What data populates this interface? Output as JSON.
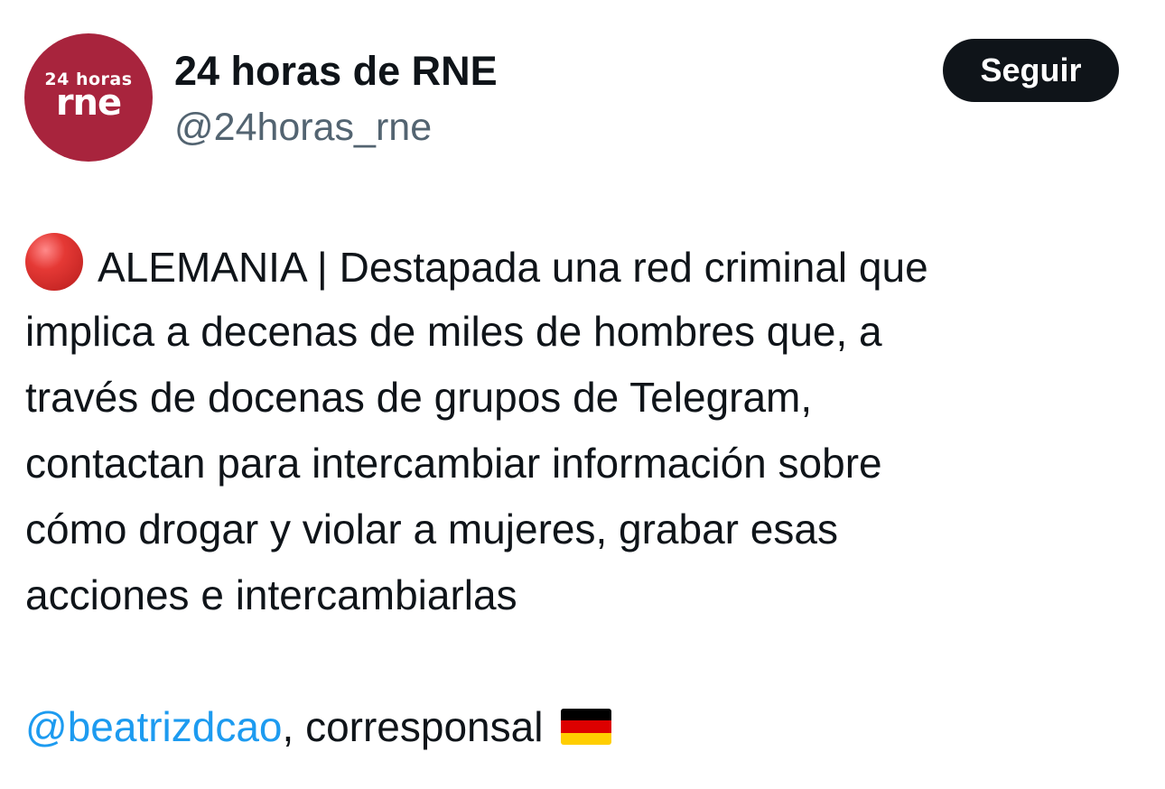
{
  "account": {
    "avatar_top": "24 horas",
    "avatar_bottom": "rne",
    "display_name": "24 horas de RNE",
    "handle": "@24horas_rne",
    "follow_label": "Seguir"
  },
  "tweet": {
    "lead_icon": "red-circle-icon",
    "lines": [
      "ALEMANIA | Destapada una red criminal que",
      "implica a decenas de miles de hombres que, a",
      "través de docenas de grupos de Telegram,",
      "contactan para intercambiar información sobre",
      "cómo drogar y violar a mujeres, grabar esas",
      "acciones e intercambiarlas"
    ],
    "mention": "@beatrizdcao",
    "mention_suffix": ", corresponsal",
    "trailing_icon": "germany-flag-icon"
  },
  "colors": {
    "avatar_bg": "#a8243d",
    "button_bg": "#0f1419",
    "handle": "#536471",
    "mention": "#1d9bf0",
    "flag_black": "#000000",
    "flag_red": "#dd0000",
    "flag_gold": "#ffce00"
  }
}
